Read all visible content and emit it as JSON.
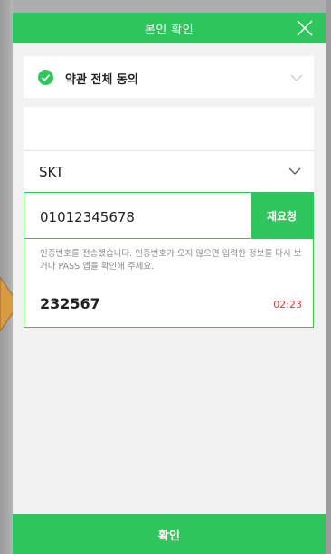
{
  "header": {
    "title": "본인 확인",
    "close_icon": "close-icon"
  },
  "terms": {
    "label": "약관 전체 동의",
    "checked": true
  },
  "carrier": {
    "selected": "SKT"
  },
  "verification": {
    "phone_number": "01012345678",
    "resend_label": "재요청",
    "notice": "인증번호를 전송했습니다. 인증번호가 오지 않으면 입력한 정보를 다시 보거나 PASS 앱을 확인해 주세요.",
    "code": "232567",
    "timer": "02:23"
  },
  "footer": {
    "confirm_label": "확인"
  },
  "colors": {
    "accent": "#2fc75b",
    "timer": "#e53935"
  }
}
